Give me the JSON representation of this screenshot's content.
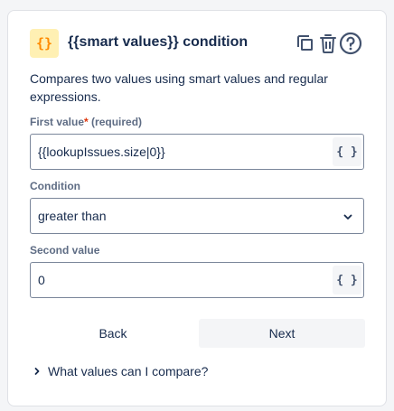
{
  "header": {
    "badge_glyph": "{}",
    "title": "{{smart values}} condition",
    "icons": [
      "copy-icon",
      "trash-icon",
      "help-icon"
    ]
  },
  "description": "Compares two values using smart values and regular expressions.",
  "first_value": {
    "label": "First value",
    "required_mark": "*",
    "required_text": "(required)",
    "value": "{{lookupIssues.size|0}}",
    "smart_button": "{ }"
  },
  "condition": {
    "label": "Condition",
    "selected": "greater than"
  },
  "second_value": {
    "label": "Second value",
    "value": "0",
    "smart_button": "{ }"
  },
  "actions": {
    "back_label": "Back",
    "next_label": "Next"
  },
  "help": {
    "expander_label": "What values can I compare?"
  },
  "colors": {
    "badge_bg": "#fff0b3",
    "badge_fg": "#ff8b00",
    "required": "#de350b",
    "text": "#172b4d",
    "subtle": "#5e6c84"
  }
}
